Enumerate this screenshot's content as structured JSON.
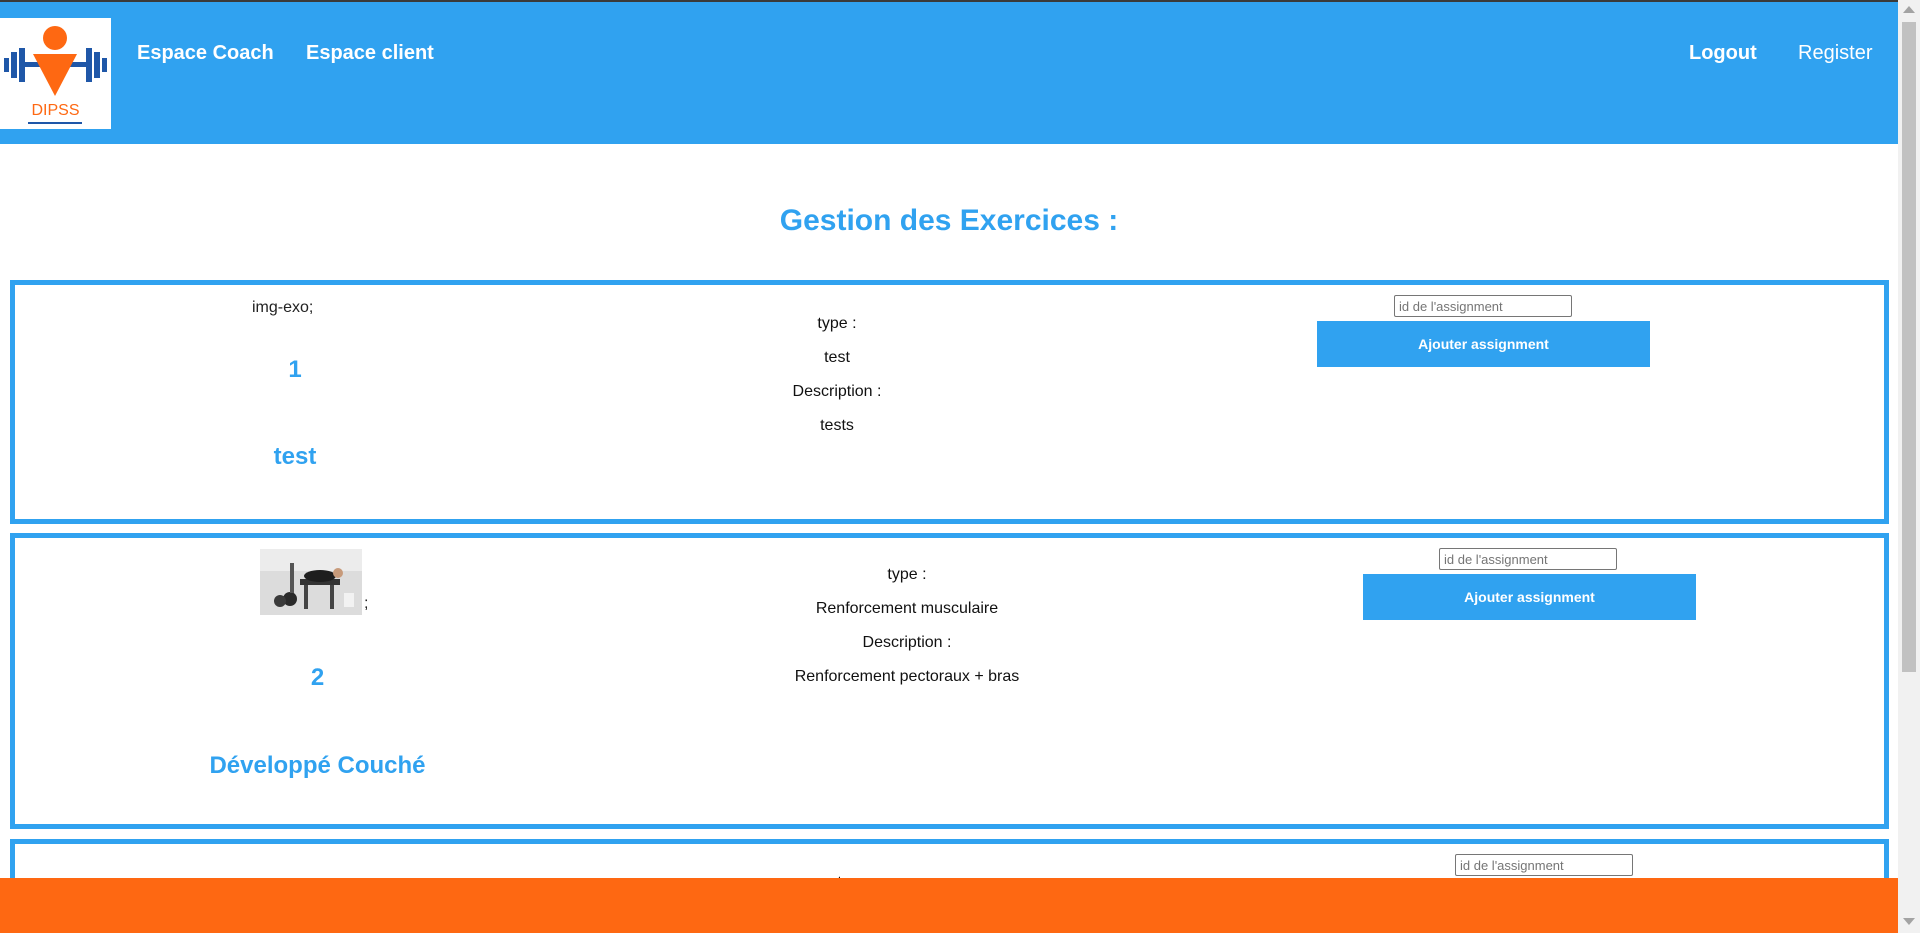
{
  "header": {
    "logo_text": "DIPSS",
    "nav_left": [
      "Espace Coach",
      "Espace client"
    ],
    "nav_right": [
      "Logout",
      "Register"
    ]
  },
  "main": {
    "title": "Gestion des Exercices :",
    "exercises": [
      {
        "img_alt": "img-exo;",
        "id": "1",
        "name": "test",
        "type_label": "type :",
        "type": "test",
        "description_label": "Description :",
        "description": "tests",
        "input_placeholder": "id de l'assignment",
        "button_label": "Ajouter assignment"
      },
      {
        "img_suffix": ";",
        "id": "2",
        "name": "Développé Couché",
        "type_label": "type :",
        "type": "Renforcement musculaire",
        "description_label": "Description :",
        "description": "Renforcement pectoraux + bras",
        "input_placeholder": "id de l'assignment",
        "button_label": "Ajouter assignment"
      },
      {
        "type_label": "type :",
        "input_placeholder": "id de l'assignment"
      }
    ]
  },
  "colors": {
    "primary": "#30a2f0",
    "footer": "#fe6812",
    "logo_orange": "#fe6812",
    "logo_blue": "#1f57a8"
  },
  "icons": [
    "logo-icon",
    "scroll-up-icon",
    "scroll-down-icon"
  ]
}
